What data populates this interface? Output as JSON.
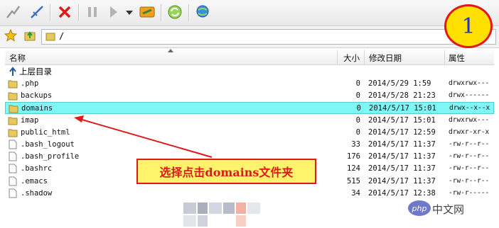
{
  "toolbar": {
    "icons": [
      "connect-icon",
      "disconnect-icon",
      "stop-icon",
      "pause-icon",
      "play-icon",
      "dropdown-icon",
      "transfer-icon",
      "refresh-icon",
      "site-icon"
    ]
  },
  "address": {
    "path": "/"
  },
  "columns": {
    "name": "名称",
    "size": "大小",
    "modified": "修改日期",
    "attributes": "属性"
  },
  "parent_dir": "上层目录",
  "files": [
    {
      "name": ".php",
      "size": "0",
      "date": "2014/5/29 1:59",
      "perm": "drwxrwx---",
      "type": "folder"
    },
    {
      "name": "backups",
      "size": "0",
      "date": "2014/5/28 21:23",
      "perm": "drwx------",
      "type": "folder"
    },
    {
      "name": "domains",
      "size": "0",
      "date": "2014/5/17 15:01",
      "perm": "drwx--x--x",
      "type": "folder",
      "selected": true
    },
    {
      "name": "imap",
      "size": "0",
      "date": "2014/5/17 15:01",
      "perm": "drwxrwx---",
      "type": "folder"
    },
    {
      "name": "public_html",
      "size": "0",
      "date": "2014/5/17 12:59",
      "perm": "drwxr-xr-x",
      "type": "folder"
    },
    {
      "name": ".bash_logout",
      "size": "33",
      "date": "2014/5/17 11:37",
      "perm": "-rw-r--r--",
      "type": "file"
    },
    {
      "name": ".bash_profile",
      "size": "176",
      "date": "2014/5/17 11:37",
      "perm": "-rw-r--r--",
      "type": "file"
    },
    {
      "name": ".bashrc",
      "size": "124",
      "date": "2014/5/17 11:37",
      "perm": "-rw-r--r--",
      "type": "file"
    },
    {
      "name": ".emacs",
      "size": "515",
      "date": "2014/5/17 11:37",
      "perm": "-rw-r--r--",
      "type": "file"
    },
    {
      "name": ".shadow",
      "size": "34",
      "date": "2014/5/17 12:38",
      "perm": "-rw-r-----",
      "type": "file"
    }
  ],
  "annotation": {
    "callout": "选择点击domains文件夹",
    "step": "1"
  },
  "watermark": {
    "text": "中文网",
    "logo": "php"
  },
  "colors": {
    "selected_row": "#7ff7f7",
    "callout_bg": "#fff36b",
    "accent_red": "#e01818",
    "badge_bg": "#ffe000",
    "badge_text": "#1a37c8"
  }
}
